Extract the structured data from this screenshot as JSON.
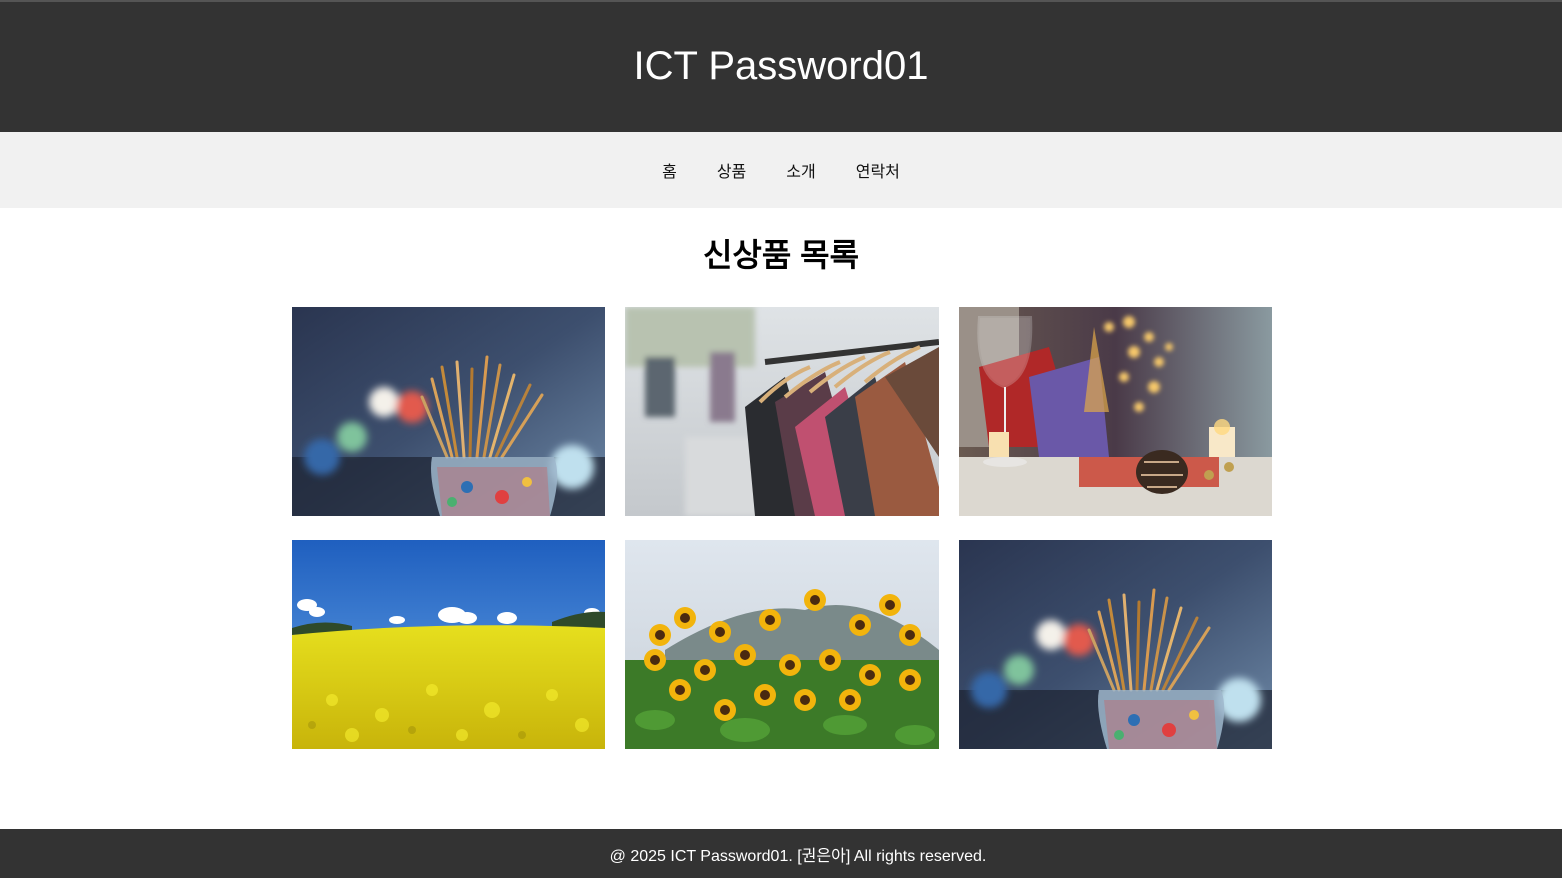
{
  "site": {
    "title": "ICT Password01"
  },
  "nav": {
    "items": [
      {
        "label": "홈"
      },
      {
        "label": "상품"
      },
      {
        "label": "소개"
      },
      {
        "label": "연락처"
      }
    ]
  },
  "main": {
    "heading": "신상품 목록"
  },
  "products": [
    {
      "image": "paintbrushes-in-jar"
    },
    {
      "image": "clothes-rack"
    },
    {
      "image": "wine-glass-candles"
    },
    {
      "image": "rapeseed-field"
    },
    {
      "image": "sunflower-field"
    },
    {
      "image": "paintbrushes-in-jar"
    }
  ],
  "footer": {
    "text": "@ 2025 ICT Password01. [권은아] All rights reserved."
  },
  "colors": {
    "header_bg": "#333333",
    "nav_bg": "#f1f1f1",
    "footer_bg": "#333333"
  }
}
